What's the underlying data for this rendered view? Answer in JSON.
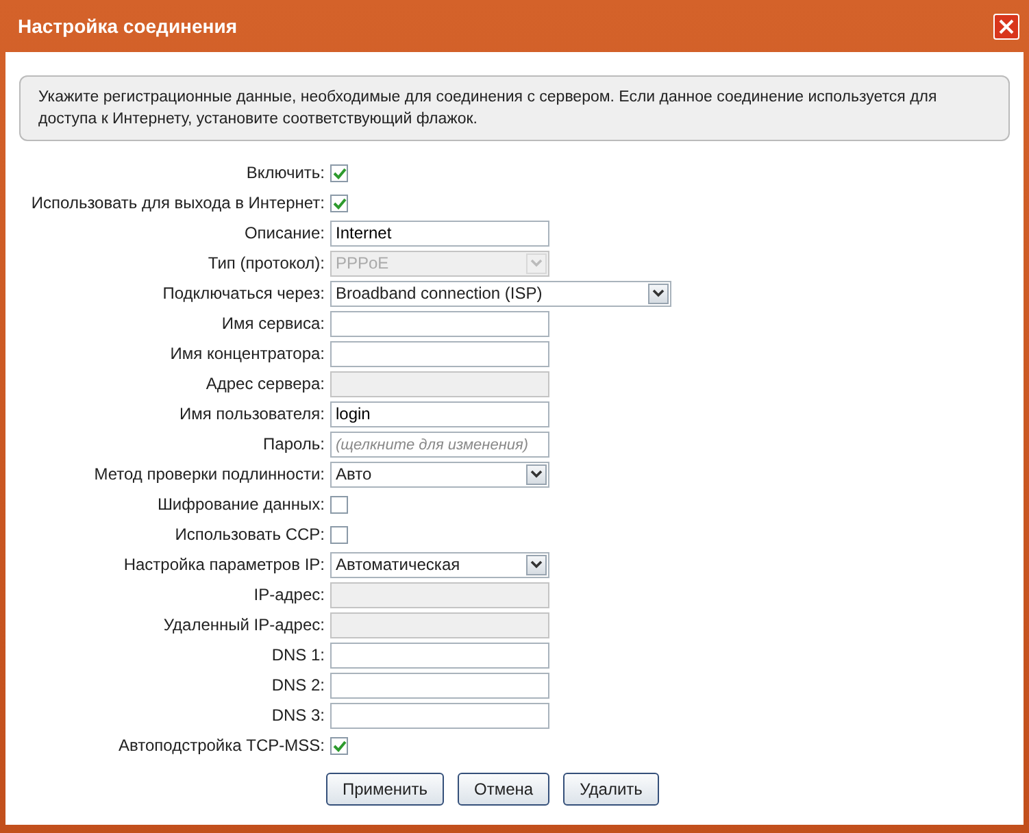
{
  "window": {
    "title": "Настройка соединения"
  },
  "info": "Укажите регистрационные данные, необходимые для соединения с сервером. Если данное соединение используется для доступа к Интернету, установите соответствующий флажок.",
  "fields": [
    {
      "kind": "checkbox",
      "label": "Включить:",
      "checked": true
    },
    {
      "kind": "checkbox",
      "label": "Использовать для выхода в Интернет:",
      "checked": true
    },
    {
      "kind": "text",
      "label": "Описание:",
      "value": "Internet",
      "disabled": false
    },
    {
      "kind": "select",
      "label": "Тип (протокол):",
      "value": "PPPoE",
      "disabled": true,
      "wide": false
    },
    {
      "kind": "select",
      "label": "Подключаться через:",
      "value": "Broadband connection (ISP)",
      "disabled": false,
      "wide": true
    },
    {
      "kind": "text",
      "label": "Имя сервиса:",
      "disabled": false
    },
    {
      "kind": "text",
      "label": "Имя концентратора:",
      "disabled": false
    },
    {
      "kind": "text",
      "label": "Адрес сервера:",
      "disabled": true
    },
    {
      "kind": "text",
      "label": "Имя пользователя:",
      "value": "login",
      "disabled": false
    },
    {
      "kind": "text",
      "label": "Пароль:",
      "placeholder": "(щелкните для изменения)",
      "disabled": false
    },
    {
      "kind": "select",
      "label": "Метод проверки подлинности:",
      "value": "Авто",
      "disabled": false,
      "wide": false
    },
    {
      "kind": "checkbox",
      "label": "Шифрование данных:",
      "checked": false
    },
    {
      "kind": "checkbox",
      "label": "Использовать CCP:",
      "checked": false
    },
    {
      "kind": "select",
      "label": "Настройка параметров IP:",
      "value": "Автоматическая",
      "disabled": false,
      "wide": false
    },
    {
      "kind": "text",
      "label": "IP-адрес:",
      "disabled": true
    },
    {
      "kind": "text",
      "label": "Удаленный IP-адрес:",
      "disabled": true
    },
    {
      "kind": "text",
      "label": "DNS 1:",
      "disabled": false
    },
    {
      "kind": "text",
      "label": "DNS 2:",
      "disabled": false
    },
    {
      "kind": "text",
      "label": "DNS 3:",
      "disabled": false
    },
    {
      "kind": "checkbox",
      "label": "Автоподстройка TCP-MSS:",
      "checked": true
    }
  ],
  "buttons": [
    "Применить",
    "Отмена",
    "Удалить"
  ]
}
